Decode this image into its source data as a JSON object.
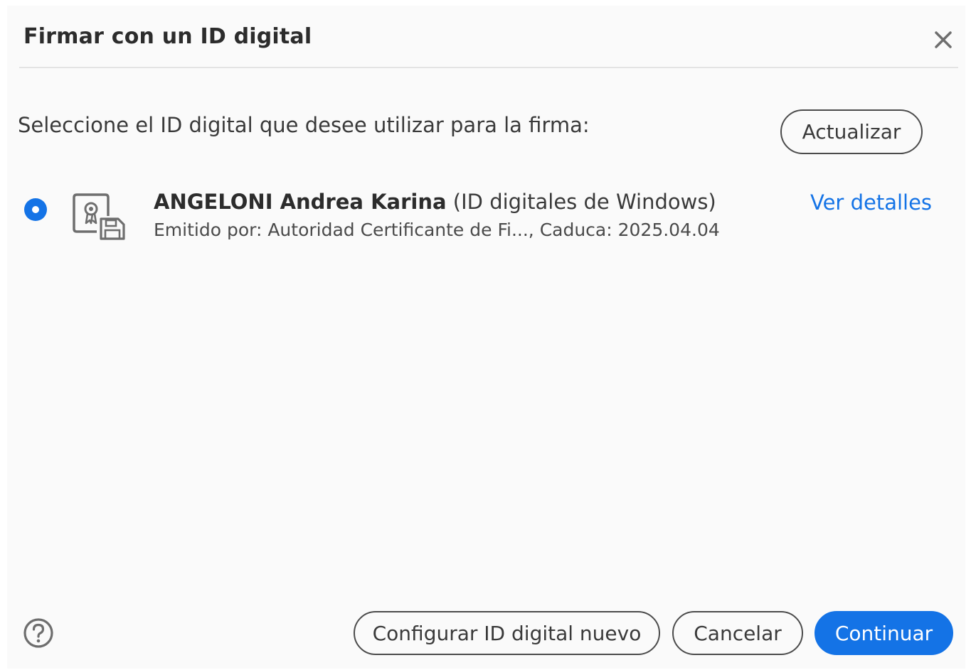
{
  "dialog": {
    "title": "Firmar con un ID digital",
    "close_icon": "close-icon",
    "prompt": "Seleccione el ID digital que desee utilizar para la firma:",
    "refresh_label": "Actualizar"
  },
  "digital_ids": [
    {
      "selected": true,
      "icon": "certificate-icon",
      "name": "ANGELONI Andrea Karina",
      "type": "(ID digitales de Windows)",
      "issued_by_label": "Emitido por:",
      "issued_by": "Autoridad Certificante de Fi...",
      "expires_label": "Caduca:",
      "expires": "2025.04.04",
      "subtitle": "Emitido por: Autoridad Certificante de Fi..., Caduca: 2025.04.04",
      "details_link": "Ver detalles"
    }
  ],
  "footer": {
    "help_icon": "help-icon",
    "configure_label": "Configurar ID digital nuevo",
    "cancel_label": "Cancelar",
    "continue_label": "Continuar"
  },
  "colors": {
    "accent": "#1473e6",
    "background": "#fafafa",
    "text": "#2c2c2c"
  }
}
